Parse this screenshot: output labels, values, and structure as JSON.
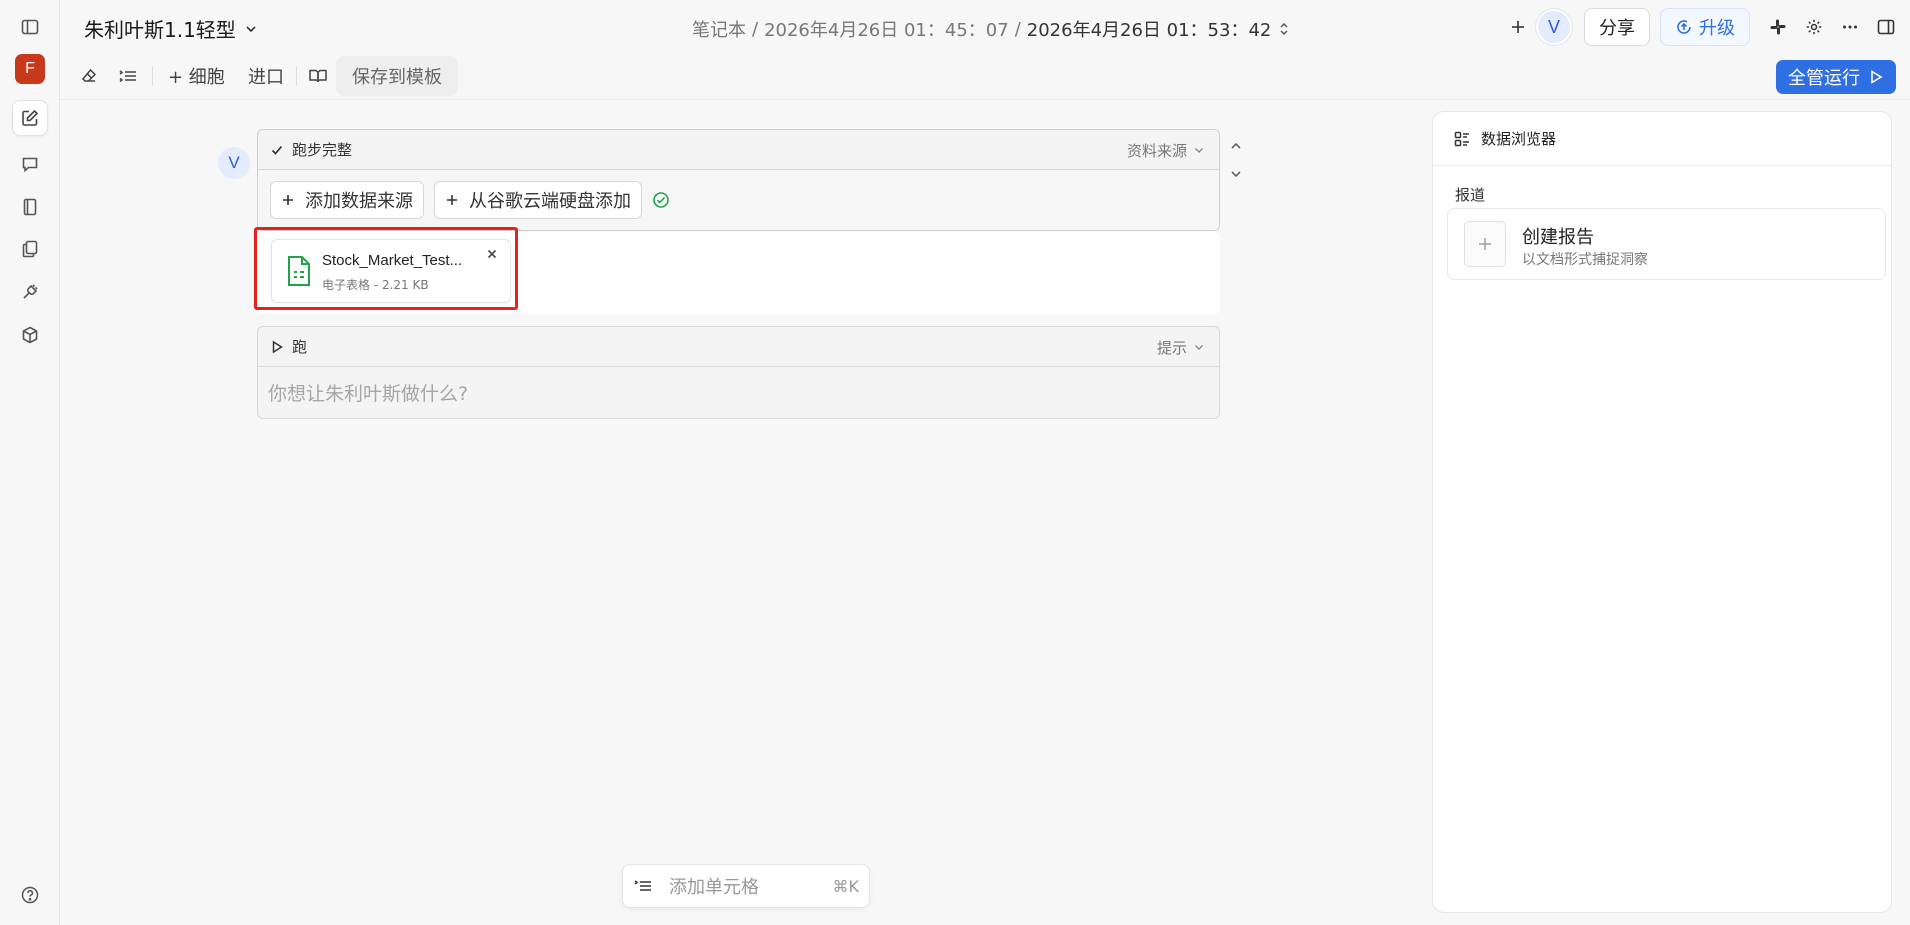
{
  "app": {
    "title": "朱利叶斯1.1轻型",
    "workspace_initial": "F",
    "user_initial": "V"
  },
  "breadcrumb": {
    "section": "笔记本",
    "separator": "/",
    "created": "2026年4月26日 01：45：07",
    "modified": "2026年4月26日 01：53：42"
  },
  "header_actions": {
    "share": "分享",
    "upgrade": "升级"
  },
  "toolbar": {
    "cell_label": "+ 细胞",
    "import_label": "进口",
    "save_template_label": "保存到模板",
    "run_all_label": "全管运行"
  },
  "data_cell": {
    "status": "跑步完整",
    "source_dropdown": "资料来源",
    "add_source": "添加数据来源",
    "add_from_drive": "从谷歌云端硬盘添加",
    "file": {
      "name": "Stock_Market_Test...",
      "meta": "电子表格 - 2.21 KB"
    }
  },
  "prompt_cell": {
    "run_label": "跑",
    "hint_dropdown": "提示",
    "placeholder": "你想让朱利叶斯做什么?"
  },
  "add_cell": {
    "label": "添加单元格",
    "shortcut": "⌘K"
  },
  "data_browser": {
    "title": "数据浏览器",
    "section": "报道",
    "report": {
      "title": "创建报告",
      "subtitle": "以文档形式捕捉洞察"
    }
  },
  "colors": {
    "accent": "#2f6fe4",
    "workspace_avatar": "#c8381b",
    "highlight": "#e5231b",
    "spreadsheet_icon": "#22a34a",
    "success": "#22a34a"
  }
}
